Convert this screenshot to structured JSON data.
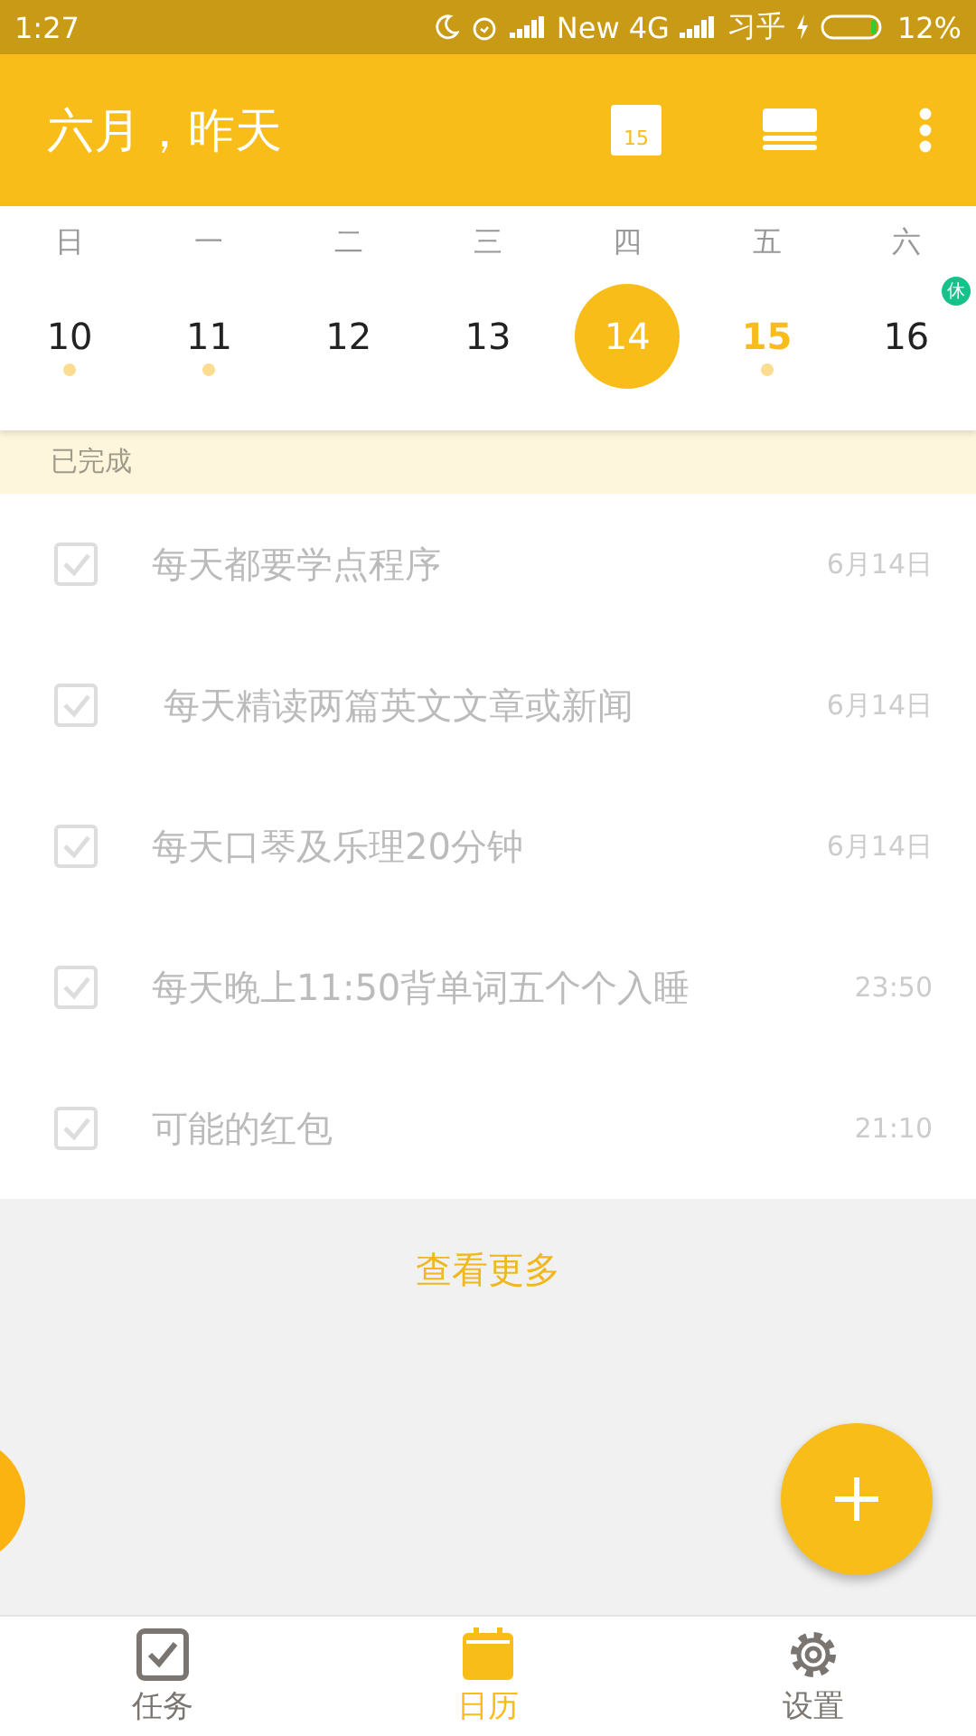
{
  "status_bar": {
    "time": "1:27",
    "carrier": "New 4G",
    "app_label": "习乎",
    "battery": "12%"
  },
  "header": {
    "title": "六月，昨天",
    "calendar_day": "15"
  },
  "week": {
    "weekdays": [
      "日",
      "一",
      "二",
      "三",
      "四",
      "五",
      "六"
    ],
    "days": [
      {
        "label": "10",
        "selected": false,
        "today": false,
        "has_tasks": true
      },
      {
        "label": "11",
        "selected": false,
        "today": false,
        "has_tasks": true
      },
      {
        "label": "12",
        "selected": false,
        "today": false,
        "has_tasks": false
      },
      {
        "label": "13",
        "selected": false,
        "today": false,
        "has_tasks": false
      },
      {
        "label": "14",
        "selected": true,
        "today": false,
        "has_tasks": false
      },
      {
        "label": "15",
        "selected": false,
        "today": true,
        "has_tasks": true
      },
      {
        "label": "16",
        "selected": false,
        "today": false,
        "has_tasks": false,
        "badge": "休"
      }
    ]
  },
  "section": {
    "title": "已完成"
  },
  "tasks": [
    {
      "text": "每天都要学点程序",
      "time": "6月14日",
      "checked": true
    },
    {
      "text": " 每天精读两篇英文文章或新闻",
      "time": "6月14日",
      "checked": true
    },
    {
      "text": "每天口琴及乐理20分钟",
      "time": "6月14日",
      "checked": true
    },
    {
      "text": "每天晚上11:50背单词五个个入睡",
      "time": "23:50",
      "checked": true
    },
    {
      "text": "可能的红包",
      "time": "21:10",
      "checked": true
    }
  ],
  "more_link": "查看更多",
  "bottom_nav": [
    {
      "label": "任务",
      "kind": "tasks",
      "selected": false
    },
    {
      "label": "日历",
      "kind": "calendar",
      "selected": true
    },
    {
      "label": "设置",
      "kind": "settings",
      "selected": false
    }
  ]
}
